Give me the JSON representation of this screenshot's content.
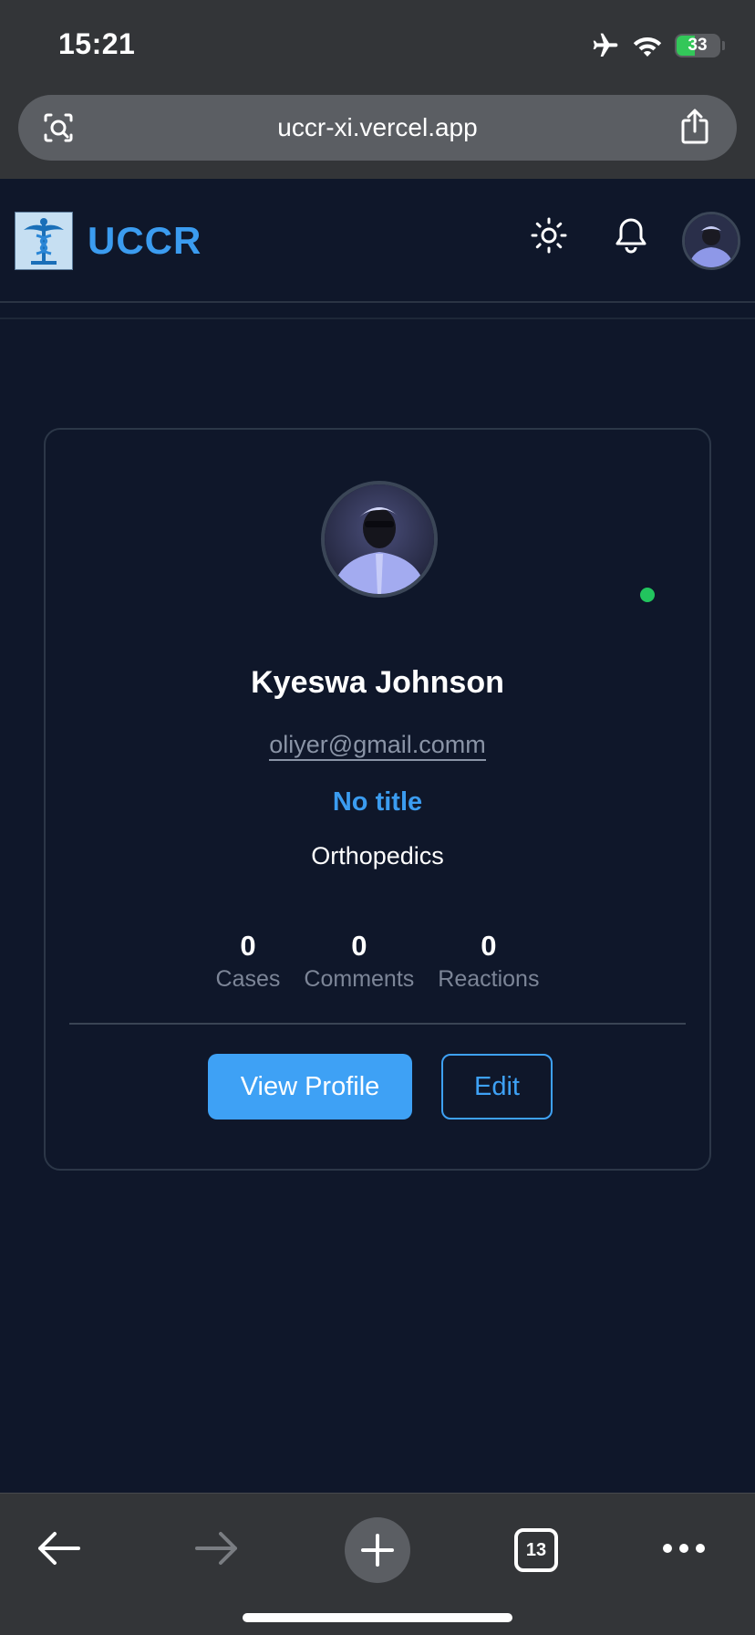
{
  "status_bar": {
    "time": "15:21",
    "battery": "33",
    "icons": [
      "airplane-icon",
      "wifi-icon",
      "battery-charging-icon"
    ]
  },
  "browser": {
    "url": "uccr-xi.vercel.app",
    "open_tabs": "13",
    "toolbar_icons": [
      "back-arrow-icon",
      "forward-arrow-icon",
      "plus-icon",
      "tabs-icon",
      "more-icon"
    ]
  },
  "header": {
    "brand": "UCCR",
    "icons": [
      "caduceus-logo",
      "sun-icon",
      "bell-icon",
      "user-avatar"
    ]
  },
  "profile": {
    "name": "Kyeswa Johnson",
    "email": "oliyer@gmail.comm",
    "title": "No title",
    "department": "Orthopedics",
    "online_status_color": "#22c55e",
    "stats": [
      {
        "value": "0",
        "label": "Cases"
      },
      {
        "value": "0",
        "label": "Comments"
      },
      {
        "value": "0",
        "label": "Reactions"
      }
    ],
    "view_profile_label": "View Profile",
    "edit_label": "Edit"
  },
  "colors": {
    "background": "#0f172a",
    "accent": "#3b9cf0",
    "browser_chrome": "#333538"
  }
}
